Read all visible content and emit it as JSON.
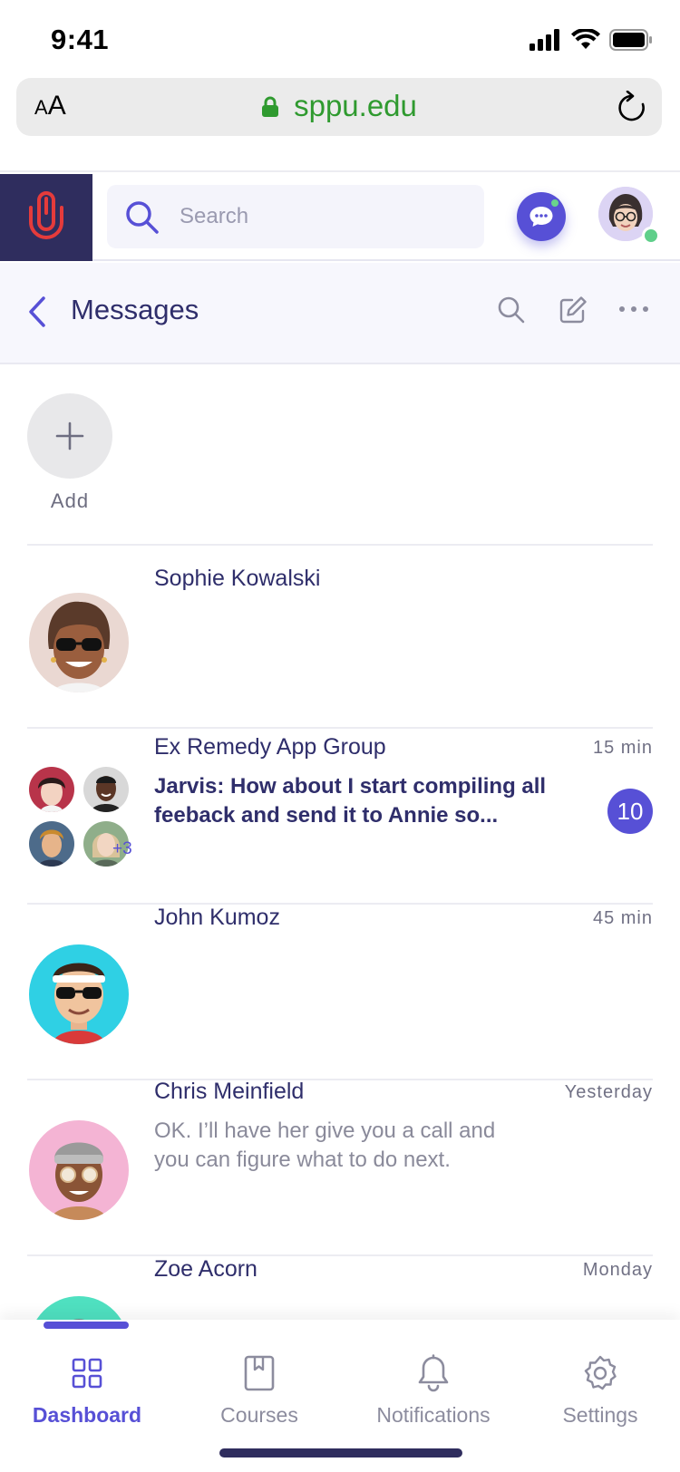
{
  "status_bar": {
    "time": "9:41"
  },
  "browser": {
    "aa_small": "A",
    "aa_large": "A",
    "url": "sppu.edu"
  },
  "header": {
    "search_placeholder": "Search"
  },
  "messages": {
    "title": "Messages"
  },
  "add": {
    "label": "Add"
  },
  "conversations": [
    {
      "name": "Sophie Kowalski",
      "time": "",
      "preview": ""
    },
    {
      "name": "Ex Remedy App Group",
      "time": "15 min",
      "preview": "Jarvis: How about I start compiling all feeback and send it to Annie so...",
      "unread": "10",
      "extra_members": "+3"
    },
    {
      "name": "John Kumoz",
      "time": "45 min",
      "preview": ""
    },
    {
      "name": "Chris Meinfield",
      "time": "Yesterday",
      "preview": "OK. I’ll have her give you a call and you can figure what to do next."
    },
    {
      "name": "Zoe Acorn",
      "time": "Monday",
      "preview": ""
    }
  ],
  "tabs": [
    {
      "label": "Dashboard",
      "icon": "dashboard-icon",
      "active": true
    },
    {
      "label": "Courses",
      "icon": "book-icon",
      "active": false
    },
    {
      "label": "Notifications",
      "icon": "bell-icon",
      "active": false
    },
    {
      "label": "Settings",
      "icon": "gear-icon",
      "active": false
    }
  ],
  "colors": {
    "accent": "#5750d6",
    "brand_dark": "#2f2d5e",
    "url_green": "#2f9a2f",
    "online": "#5fcf8a"
  }
}
